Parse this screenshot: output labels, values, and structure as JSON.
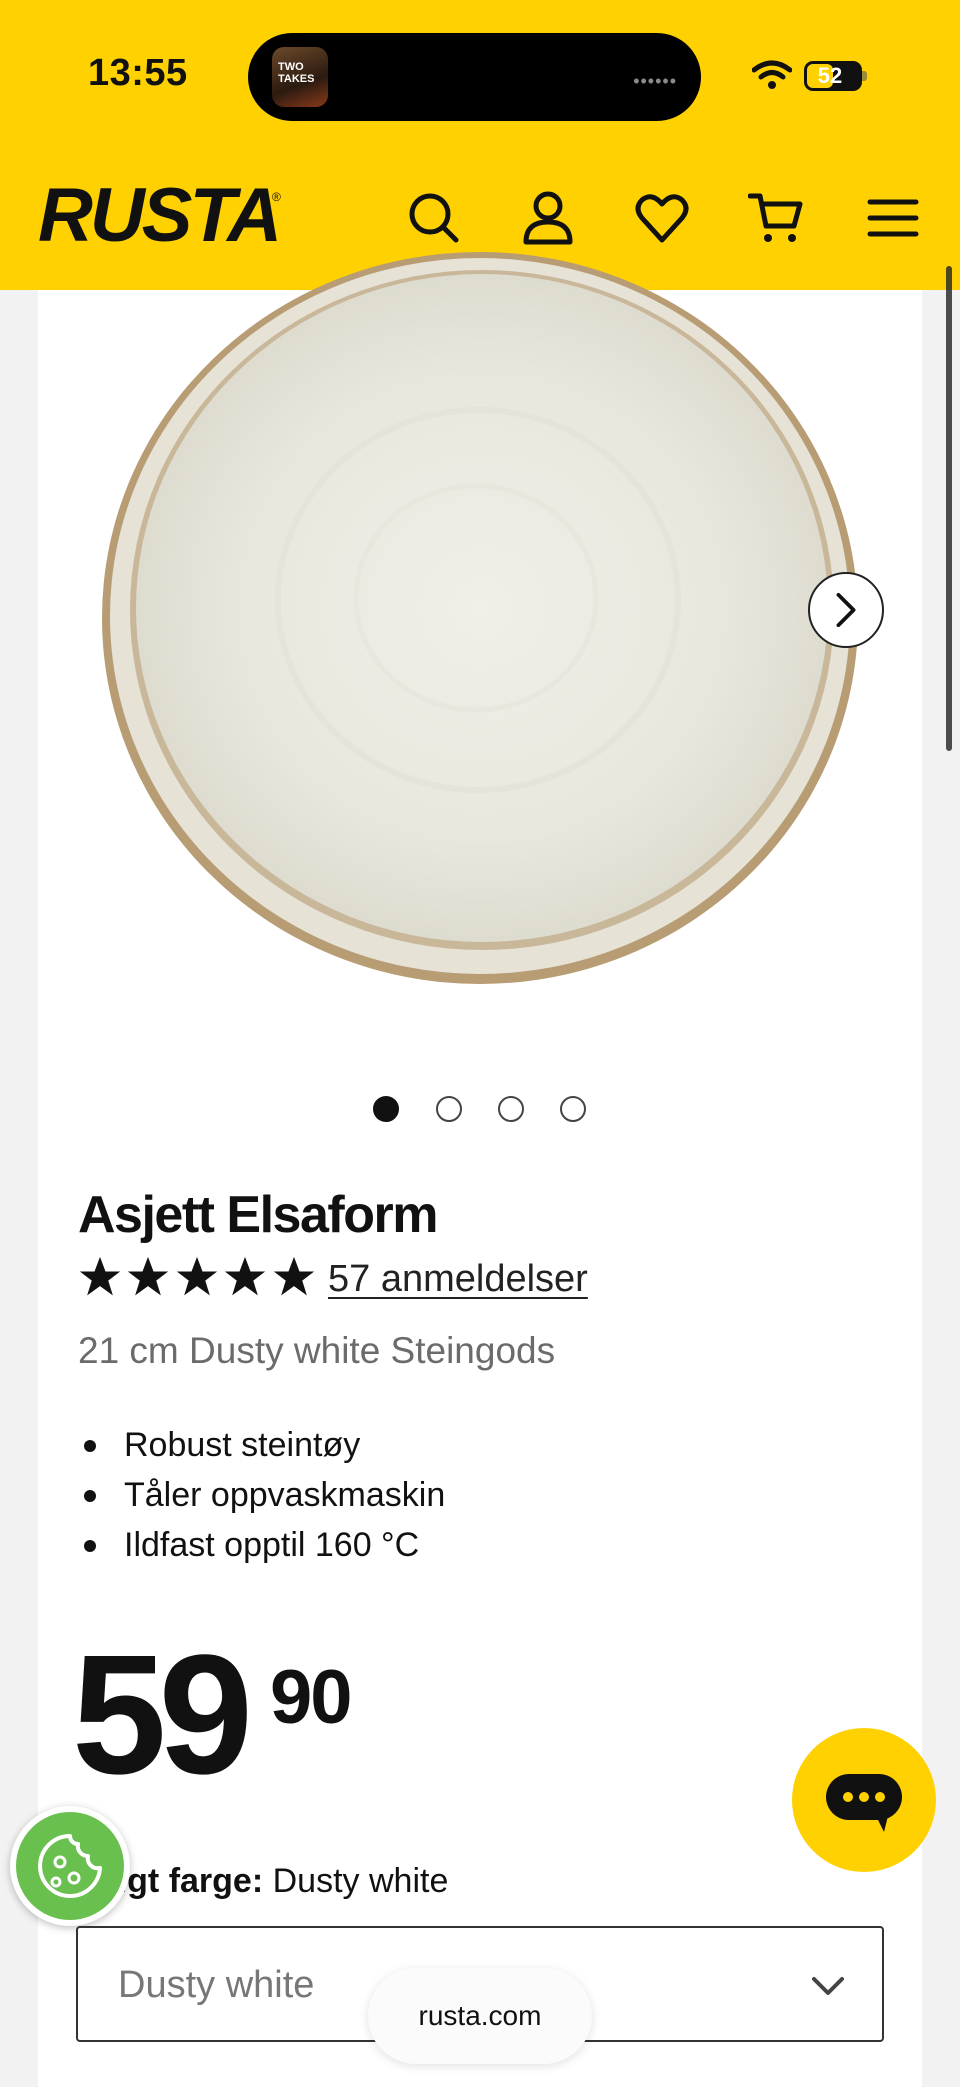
{
  "status_bar": {
    "time": "13:55",
    "live_activity_app": "TWO TAKES",
    "battery": "52"
  },
  "header": {
    "logo": "RUSTA",
    "icons": [
      "search-icon",
      "account-icon",
      "wishlist-heart-icon",
      "cart-icon",
      "menu-icon"
    ]
  },
  "gallery": {
    "image_alt": "Asjett Elsaform plate",
    "slide_count": 4,
    "active_slide": 1
  },
  "product": {
    "title": "Asjett Elsaform",
    "rating": 5,
    "reviews_label": "57 anmeldelser",
    "subtitle": "21 cm Dusty white Steingods",
    "features": [
      "Robust steintøy",
      "Tåler oppvaskmaskin",
      "Ildfast opptil 160 °C"
    ],
    "price_main": "59",
    "price_decimals": "90",
    "color_label": "Valgt farge:",
    "color_value": "Dusty white",
    "color_select_value": "Dusty white"
  },
  "browser": {
    "url": "rusta.com"
  },
  "colors": {
    "brand_yellow": "#ffd100",
    "cookie_green": "#6ac04f"
  }
}
